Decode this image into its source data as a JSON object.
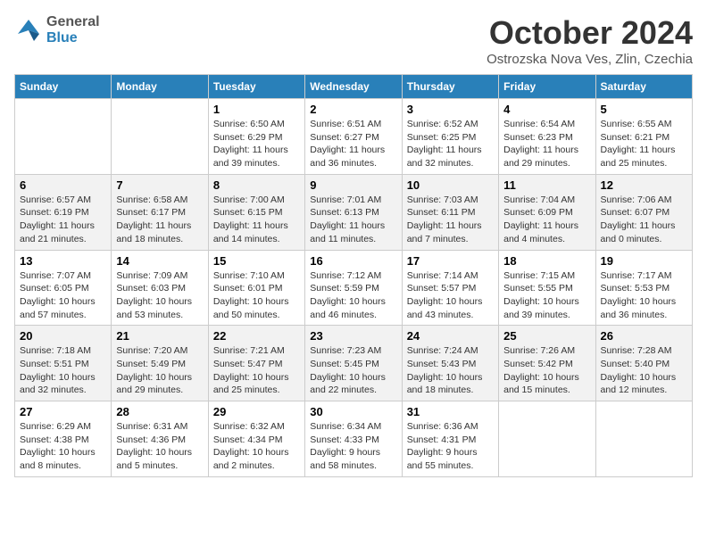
{
  "header": {
    "logo": {
      "general": "General",
      "blue": "Blue"
    },
    "title": "October 2024",
    "subtitle": "Ostrozska Nova Ves, Zlin, Czechia"
  },
  "calendar": {
    "days_of_week": [
      "Sunday",
      "Monday",
      "Tuesday",
      "Wednesday",
      "Thursday",
      "Friday",
      "Saturday"
    ],
    "weeks": [
      [
        {
          "day": "",
          "info": ""
        },
        {
          "day": "",
          "info": ""
        },
        {
          "day": "1",
          "info": "Sunrise: 6:50 AM\nSunset: 6:29 PM\nDaylight: 11 hours and 39 minutes."
        },
        {
          "day": "2",
          "info": "Sunrise: 6:51 AM\nSunset: 6:27 PM\nDaylight: 11 hours and 36 minutes."
        },
        {
          "day": "3",
          "info": "Sunrise: 6:52 AM\nSunset: 6:25 PM\nDaylight: 11 hours and 32 minutes."
        },
        {
          "day": "4",
          "info": "Sunrise: 6:54 AM\nSunset: 6:23 PM\nDaylight: 11 hours and 29 minutes."
        },
        {
          "day": "5",
          "info": "Sunrise: 6:55 AM\nSunset: 6:21 PM\nDaylight: 11 hours and 25 minutes."
        }
      ],
      [
        {
          "day": "6",
          "info": "Sunrise: 6:57 AM\nSunset: 6:19 PM\nDaylight: 11 hours and 21 minutes."
        },
        {
          "day": "7",
          "info": "Sunrise: 6:58 AM\nSunset: 6:17 PM\nDaylight: 11 hours and 18 minutes."
        },
        {
          "day": "8",
          "info": "Sunrise: 7:00 AM\nSunset: 6:15 PM\nDaylight: 11 hours and 14 minutes."
        },
        {
          "day": "9",
          "info": "Sunrise: 7:01 AM\nSunset: 6:13 PM\nDaylight: 11 hours and 11 minutes."
        },
        {
          "day": "10",
          "info": "Sunrise: 7:03 AM\nSunset: 6:11 PM\nDaylight: 11 hours and 7 minutes."
        },
        {
          "day": "11",
          "info": "Sunrise: 7:04 AM\nSunset: 6:09 PM\nDaylight: 11 hours and 4 minutes."
        },
        {
          "day": "12",
          "info": "Sunrise: 7:06 AM\nSunset: 6:07 PM\nDaylight: 11 hours and 0 minutes."
        }
      ],
      [
        {
          "day": "13",
          "info": "Sunrise: 7:07 AM\nSunset: 6:05 PM\nDaylight: 10 hours and 57 minutes."
        },
        {
          "day": "14",
          "info": "Sunrise: 7:09 AM\nSunset: 6:03 PM\nDaylight: 10 hours and 53 minutes."
        },
        {
          "day": "15",
          "info": "Sunrise: 7:10 AM\nSunset: 6:01 PM\nDaylight: 10 hours and 50 minutes."
        },
        {
          "day": "16",
          "info": "Sunrise: 7:12 AM\nSunset: 5:59 PM\nDaylight: 10 hours and 46 minutes."
        },
        {
          "day": "17",
          "info": "Sunrise: 7:14 AM\nSunset: 5:57 PM\nDaylight: 10 hours and 43 minutes."
        },
        {
          "day": "18",
          "info": "Sunrise: 7:15 AM\nSunset: 5:55 PM\nDaylight: 10 hours and 39 minutes."
        },
        {
          "day": "19",
          "info": "Sunrise: 7:17 AM\nSunset: 5:53 PM\nDaylight: 10 hours and 36 minutes."
        }
      ],
      [
        {
          "day": "20",
          "info": "Sunrise: 7:18 AM\nSunset: 5:51 PM\nDaylight: 10 hours and 32 minutes."
        },
        {
          "day": "21",
          "info": "Sunrise: 7:20 AM\nSunset: 5:49 PM\nDaylight: 10 hours and 29 minutes."
        },
        {
          "day": "22",
          "info": "Sunrise: 7:21 AM\nSunset: 5:47 PM\nDaylight: 10 hours and 25 minutes."
        },
        {
          "day": "23",
          "info": "Sunrise: 7:23 AM\nSunset: 5:45 PM\nDaylight: 10 hours and 22 minutes."
        },
        {
          "day": "24",
          "info": "Sunrise: 7:24 AM\nSunset: 5:43 PM\nDaylight: 10 hours and 18 minutes."
        },
        {
          "day": "25",
          "info": "Sunrise: 7:26 AM\nSunset: 5:42 PM\nDaylight: 10 hours and 15 minutes."
        },
        {
          "day": "26",
          "info": "Sunrise: 7:28 AM\nSunset: 5:40 PM\nDaylight: 10 hours and 12 minutes."
        }
      ],
      [
        {
          "day": "27",
          "info": "Sunrise: 6:29 AM\nSunset: 4:38 PM\nDaylight: 10 hours and 8 minutes."
        },
        {
          "day": "28",
          "info": "Sunrise: 6:31 AM\nSunset: 4:36 PM\nDaylight: 10 hours and 5 minutes."
        },
        {
          "day": "29",
          "info": "Sunrise: 6:32 AM\nSunset: 4:34 PM\nDaylight: 10 hours and 2 minutes."
        },
        {
          "day": "30",
          "info": "Sunrise: 6:34 AM\nSunset: 4:33 PM\nDaylight: 9 hours and 58 minutes."
        },
        {
          "day": "31",
          "info": "Sunrise: 6:36 AM\nSunset: 4:31 PM\nDaylight: 9 hours and 55 minutes."
        },
        {
          "day": "",
          "info": ""
        },
        {
          "day": "",
          "info": ""
        }
      ]
    ]
  }
}
